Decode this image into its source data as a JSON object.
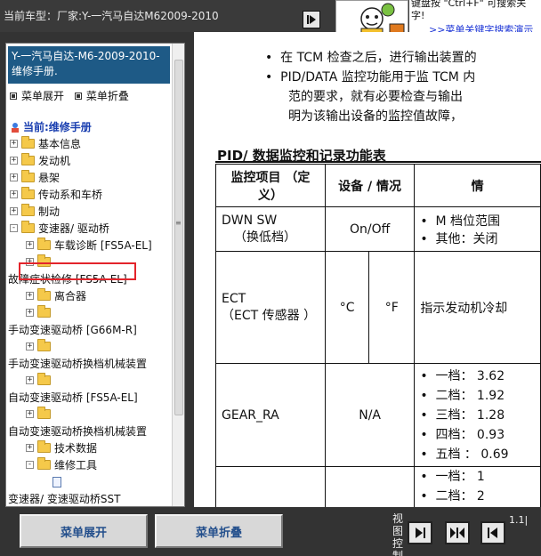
{
  "topbar": {
    "vehicle_label": "当前车型：厂家:Y-一汽马自达M62009-2010",
    "hint_line1": "键盘按 \"Ctrl+F\" 可搜索关",
    "hint_line2": "字!",
    "hint_link": ">>菜单关键字搜索演示"
  },
  "sidebar": {
    "manual_title": "Y-一汽马自达-M6-2009-2010- 维修手册.",
    "expand_label": "菜单展开",
    "collapse_label": "菜单折叠",
    "current_label": "当前:维修手册",
    "items": [
      {
        "label": "基本信息"
      },
      {
        "label": "发动机"
      },
      {
        "label": "悬架"
      },
      {
        "label": "传动系和车桥"
      },
      {
        "label": "制动"
      },
      {
        "label": "变速器/ 驱动桥"
      },
      {
        "label": "车载诊断 [FS5A-EL]"
      },
      {
        "label": ""
      },
      {
        "label": "故障症状检修 [FS5A-EL]"
      },
      {
        "label": "离合器"
      },
      {
        "label": ""
      },
      {
        "label": "手动变速驱动桥 [G66M-R]"
      },
      {
        "label": ""
      },
      {
        "label": "手动变速驱动桥换档机械装置"
      },
      {
        "label": ""
      },
      {
        "label": "自动变速驱动桥 [FS5A-EL]"
      },
      {
        "label": ""
      },
      {
        "label": "自动变速驱动桥换档机械装置"
      },
      {
        "label": "技术数据"
      },
      {
        "label": "维修工具"
      },
      {
        "label": ""
      },
      {
        "label": "变速器/ 变速驱动桥SST"
      }
    ]
  },
  "content": {
    "bullet1": "在 TCM 检查之后，进行输出装置的",
    "bullet2_line1": "PID/DATA 监控功能用于监 TCM 内",
    "bullet2_line2": "范的要求，就有必要检查与输出",
    "bullet2_line3": "明为该输出设备的监控值故障，",
    "section_title": "PID/ 数据监控和记录功能表",
    "headers": {
      "item": "监控项目 （定义）",
      "unit": "设备 / 情况",
      "cond": "情"
    },
    "rows": {
      "dwn_name": "DWN SW",
      "dwn_def": "（换低档）",
      "dwn_unit": "On/Off",
      "dwn_c1": "M 档位范围",
      "dwn_c2": "其他：关闭",
      "ect_name": "ECT",
      "ect_def": "（ECT 传感器 ）",
      "ect_u1": "°C",
      "ect_u2": "°F",
      "ect_c": "指示发动机冷却",
      "gear_name": "GEAR_RA",
      "gear_unit": "N/A",
      "gear_c1": "一档： 3.62",
      "gear_c2": "二档： 1.92",
      "gear_c3": "三档： 1.28",
      "gear_c4": "四档： 0.93",
      "gear_c5": "五档 ： 0.69",
      "last_c1": "一档： 1",
      "last_c2": "二档： 2"
    }
  },
  "bottombar": {
    "expand_button": "菜单展开",
    "collapse_button": "菜单折叠",
    "view_label": "视图控制",
    "version": "1.1|"
  }
}
